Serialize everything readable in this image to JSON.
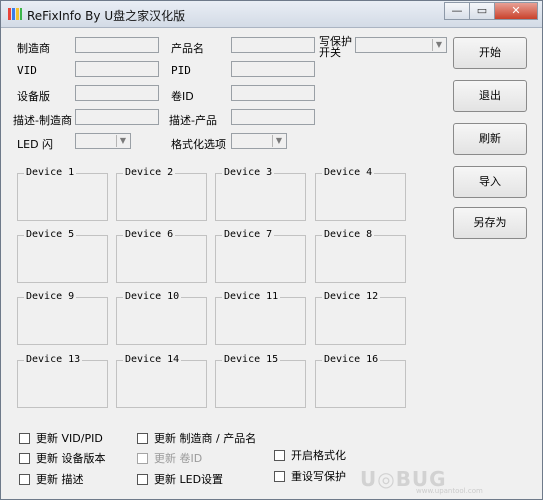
{
  "window": {
    "title": "ReFixInfo By U盘之家汉化版"
  },
  "controls": {
    "min": "—",
    "max": "▭",
    "close": "✕"
  },
  "fields": {
    "manufacturer": "制造商",
    "product_name": "产品名",
    "write_protect": "写保护\n开关",
    "vid": "VID",
    "pid": "PID",
    "device_version": "设备版",
    "volume_id": "卷ID",
    "desc_manufacturer": "描述-制造商",
    "desc_product": "描述-产品",
    "led_blink": "LED 闪",
    "format_option": "格式化选项"
  },
  "buttons": {
    "start": "开始",
    "exit": "退出",
    "refresh": "刷新",
    "import": "导入",
    "save_as": "另存为"
  },
  "devices": [
    "Device 1",
    "Device 2",
    "Device 3",
    "Device 4",
    "Device 5",
    "Device 6",
    "Device 7",
    "Device 8",
    "Device 9",
    "Device 10",
    "Device 11",
    "Device 12",
    "Device 13",
    "Device 14",
    "Device 15",
    "Device 16"
  ],
  "checkboxes": {
    "update_vid_pid": "更新 VID/PID",
    "update_mfr_product": "更新 制造商 / 产品名",
    "update_device_version": "更新 设备版本",
    "update_volume_id": "更新 卷ID",
    "enable_format": "开启格式化",
    "update_desc": "更新 描述",
    "update_led": "更新 LED设置",
    "reset_write_protect": "重设写保护"
  },
  "watermark": {
    "text": "U◎BUG",
    "sub": "www.upantool.com"
  }
}
